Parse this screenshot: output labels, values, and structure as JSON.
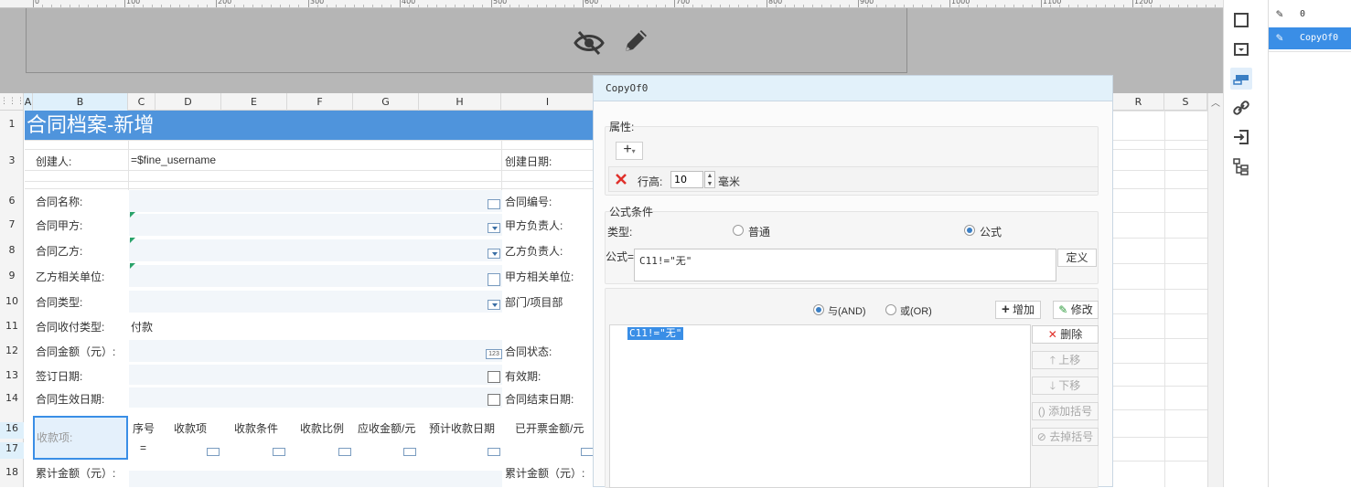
{
  "ruler": {
    "labels": [
      "0",
      "100",
      "200",
      "300",
      "400",
      "500",
      "600",
      "700",
      "800",
      "900",
      "1000",
      "1100",
      "1200"
    ]
  },
  "preview": {
    "icons": [
      "eye-slash-icon",
      "pencil-icon"
    ]
  },
  "columns": [
    "A",
    "B",
    "C",
    "D",
    "E",
    "F",
    "G",
    "H",
    "I",
    "R",
    "S"
  ],
  "rows": [
    "1",
    "3",
    "6",
    "7",
    "8",
    "9",
    "10",
    "11",
    "12",
    "13",
    "14",
    "16",
    "17",
    "18"
  ],
  "sheet": {
    "title": "合同档案-新增",
    "creator_label": "创建人:",
    "creator_value": "=$fine_username",
    "create_date_label": "创建日期:",
    "left_labels": [
      "合同名称:",
      "合同甲方:",
      "合同乙方:",
      "乙方相关单位:",
      "合同类型:",
      "合同收付类型:",
      "合同金额（元）:",
      "签订日期:",
      "合同生效日期:"
    ],
    "right_labels": [
      "合同编号:",
      "甲方负责人:",
      "乙方负责人:",
      "甲方相关单位:",
      "部门/项目部",
      "合同状态:",
      "有效期:",
      "合同结束日期:"
    ],
    "payment_type_value": "付款",
    "payment_section_label": "收款项:",
    "payment_headers": [
      "序号",
      "收款项",
      "收款条件",
      "收款比例",
      "应收金额/元",
      "预计收款日期",
      "已开票金额/元"
    ],
    "row17_marker": "=",
    "total_left": "累计金额（元）:",
    "total_right": "累计金额（元）:"
  },
  "dialog": {
    "title": "CopyOf0",
    "attr_label": "属性:",
    "add_symbol": "+",
    "row_height_label": "行高:",
    "row_height_value": "10",
    "row_height_unit": "毫米",
    "formula_cond_label": "公式条件",
    "type_label": "类型:",
    "type_normal": "普通",
    "type_formula": "公式",
    "formula_label": "公式=",
    "formula_value": "C11!=\"无\"",
    "define_button": "定义",
    "and_label": "与(AND)",
    "or_label": "或(OR)",
    "add_button": "增加",
    "modify_button": "修改",
    "list_items": [
      "C11!=\"无\""
    ],
    "delete_button": "删除",
    "up_button": "上移",
    "down_button": "下移",
    "add_paren_button": "添加括号",
    "remove_paren_button": "去掉括号"
  },
  "right_panel": {
    "items": [
      {
        "label": "0",
        "selected": false
      },
      {
        "label": "CopyOf0",
        "selected": true
      }
    ]
  },
  "toolbar": {
    "icons": [
      "square-icon",
      "dropdown-box-icon",
      "condition-attr-icon",
      "link-icon",
      "import-icon",
      "tree-icon"
    ]
  },
  "colors": {
    "title_bar": "#4f94dc",
    "selected": "#3a8ee6",
    "accent": "#3b7fc4"
  }
}
